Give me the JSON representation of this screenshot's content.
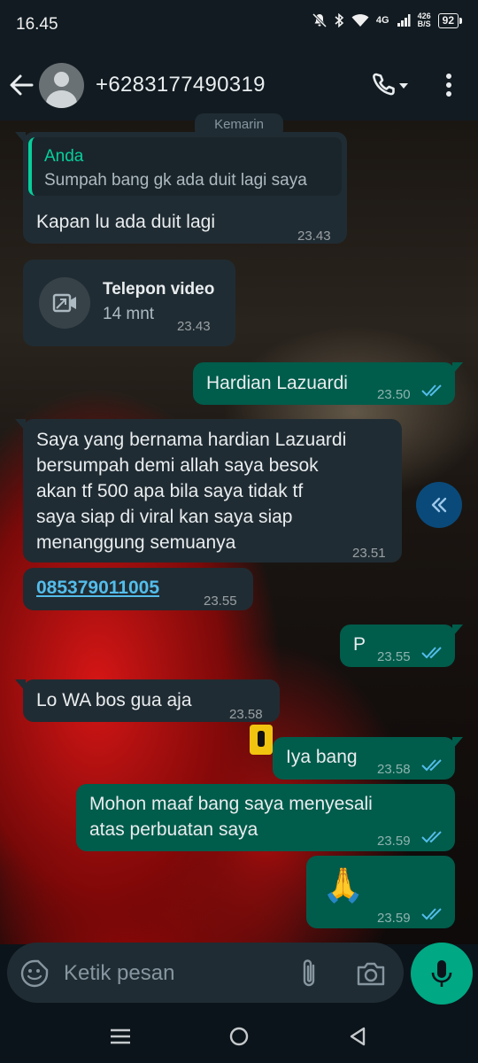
{
  "status_bar": {
    "time": "16.45",
    "network": "4G",
    "speed_value": "426",
    "speed_unit": "B/S",
    "battery": "92"
  },
  "header": {
    "contact_name": "+6283177490319"
  },
  "date_chip": "Kemarin",
  "messages": [
    {
      "id": "m1",
      "direction": "in",
      "quote_sender": "Anda",
      "quote_text": "Sumpah bang gk ada duit lagi saya",
      "text": "Kapan lu ada duit lagi",
      "time": "23.43"
    },
    {
      "id": "m2",
      "direction": "in",
      "type": "video-call",
      "title": "Telepon video",
      "duration": "14 mnt",
      "time": "23.43"
    },
    {
      "id": "m3",
      "direction": "out",
      "text": "Hardian Lazuardi",
      "time": "23.50",
      "status": "read"
    },
    {
      "id": "m4",
      "direction": "in",
      "lines": [
        "Saya yang bernama hardian Lazuardi",
        "bersumpah demi allah saya besok",
        "akan tf 500 apa bila saya tidak tf",
        "saya siap di viral kan saya siap",
        "menanggung semuanya"
      ],
      "time": "23.51"
    },
    {
      "id": "m5",
      "direction": "in",
      "link": "085379011005",
      "time": "23.55"
    },
    {
      "id": "m6",
      "direction": "out",
      "text": "P",
      "time": "23.55",
      "status": "read"
    },
    {
      "id": "m7",
      "direction": "in",
      "text": "Lo WA bos gua aja",
      "time": "23.58"
    },
    {
      "id": "m8",
      "direction": "out",
      "text": "Iya bang",
      "time": "23.58",
      "status": "read"
    },
    {
      "id": "m9",
      "direction": "out",
      "lines": [
        "Mohon maaf bang saya menyesali",
        "atas perbuatan saya"
      ],
      "time": "23.59",
      "status": "read"
    },
    {
      "id": "m10",
      "direction": "out",
      "text": "🙏",
      "time": "23.59",
      "status": "read"
    }
  ],
  "composer": {
    "placeholder": "Ketik pesan"
  },
  "colors": {
    "incoming_bubble": "#202c33",
    "outgoing_bubble": "#005c4b",
    "read_ticks": "#53bdeb",
    "link": "#53bdeb",
    "mic_button": "#00a884",
    "quote_accent": "#06cf9c"
  },
  "icons": [
    "back-arrow-icon",
    "avatar-icon",
    "phone-icon",
    "chevron-down-icon",
    "more-vert-icon",
    "video-call-icon",
    "double-check-icon",
    "double-chevron-left-icon",
    "emoji-icon",
    "attach-icon",
    "camera-icon",
    "mic-icon",
    "nav-recents-icon",
    "nav-home-icon",
    "nav-back-icon"
  ]
}
